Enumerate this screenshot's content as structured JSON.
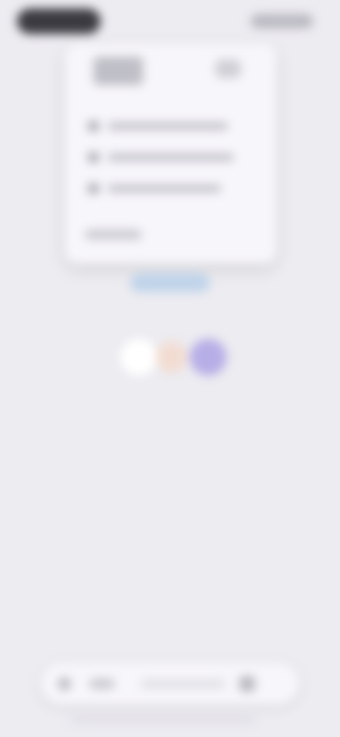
{
  "screen": {
    "state": "blurred",
    "background_color": "#edecf1"
  },
  "status_bar": {
    "left_pill": "",
    "right_icons": ""
  },
  "card": {
    "logo_text": "",
    "action_label": "",
    "rows": [
      "",
      "",
      ""
    ],
    "footer_text": ""
  },
  "link": {
    "label": ""
  },
  "dots": {
    "colors": [
      "#ffffff",
      "#f2dcd2",
      "#b6aee6"
    ]
  },
  "bottom_bar": {
    "left_icon": "circle-icon",
    "left_text": "",
    "middle_text": "",
    "right_icon": "mic-icon"
  }
}
